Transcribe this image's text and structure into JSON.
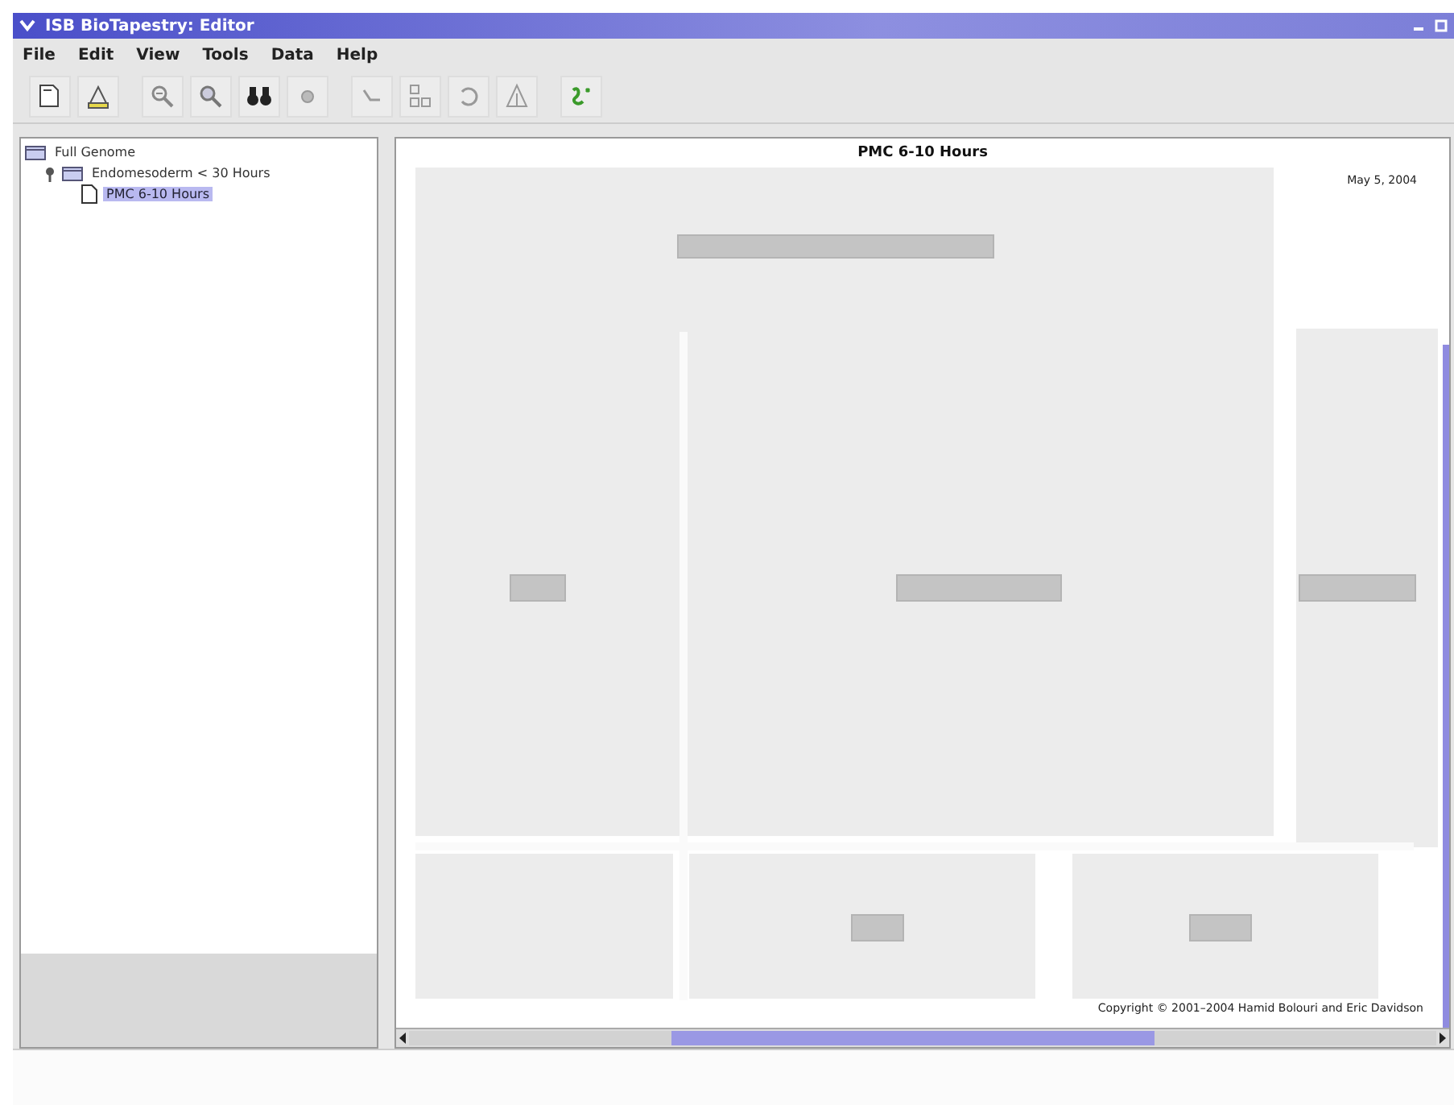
{
  "window": {
    "title": "ISB BioTapestry: Editor"
  },
  "menu": [
    "File",
    "Edit",
    "View",
    "Tools",
    "Data",
    "Help"
  ],
  "tree": [
    {
      "label": "Full Genome",
      "selected": false,
      "children": [
        {
          "label": "Endomesoderm < 30 Hours",
          "selected": false,
          "expanded": true,
          "children": [
            {
              "label": "PMC 6-10 Hours",
              "selected": true
            }
          ]
        }
      ]
    }
  ],
  "canvas": {
    "title": "PMC 6-10 Hours",
    "date": "May 5, 2004",
    "copyright": "Copyright © 2001–2004 Hamid Bolouri and Eric Davidson"
  }
}
